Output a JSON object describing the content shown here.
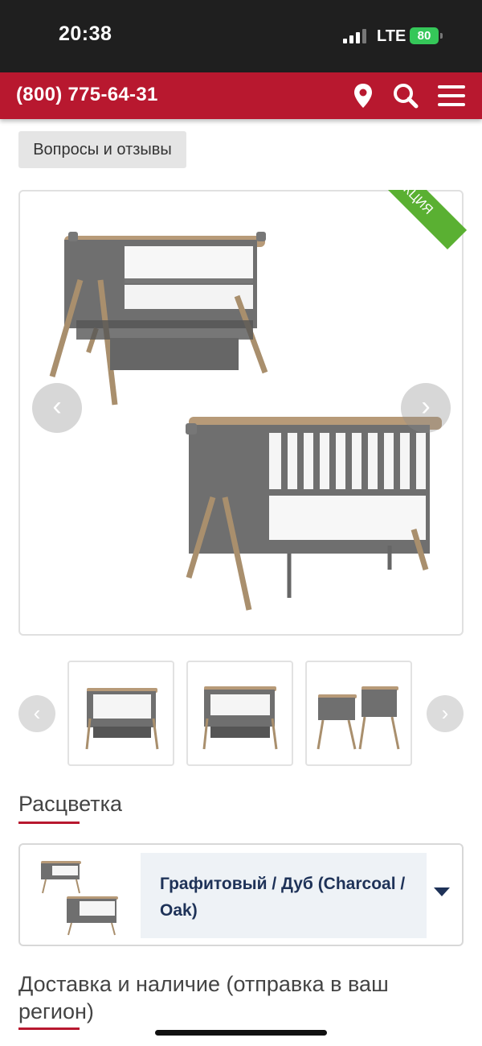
{
  "status_bar": {
    "time": "20:38",
    "network": "LTE",
    "battery": "80"
  },
  "header": {
    "phone": "(800) 775-64-31"
  },
  "tabs": {
    "reviews_label": "Вопросы и отзывы"
  },
  "gallery": {
    "promo_badge": "АКЦИЯ",
    "prev_arrow": "‹",
    "next_arrow": "›"
  },
  "color_section": {
    "title": "Расцветка",
    "selected_value": "Графитовый / Дуб (Charcoal / Oak)"
  },
  "delivery_section": {
    "title": "Доставка и наличие (отправка в ваш регион)"
  },
  "colors": {
    "brand_red": "#b8182f",
    "promo_green": "#5ab032",
    "select_text": "#1e3258"
  }
}
